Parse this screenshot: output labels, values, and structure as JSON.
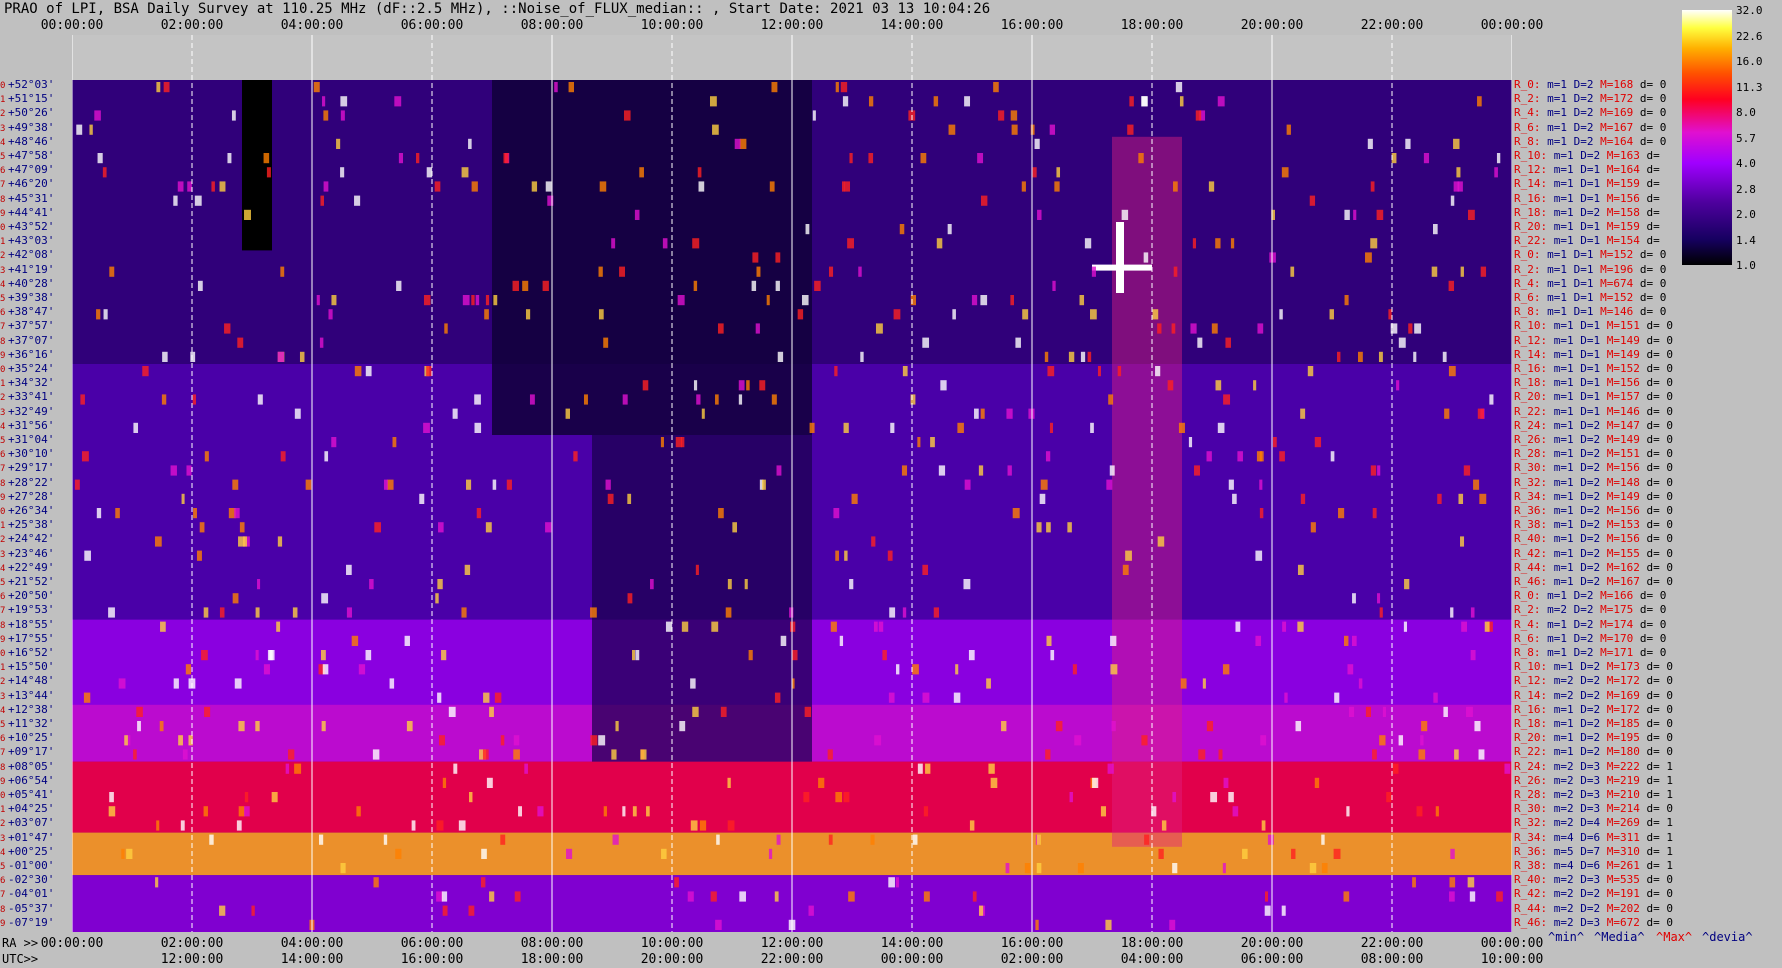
{
  "title": "PRAO of LPI, BSA Daily Survey at 110.25 MHz (dF::2.5 MHz), ::Noise_of_FLUX_median:: , Start Date: 2021 03 13 10:04:26",
  "top_ticks": [
    "00:00:00",
    "02:00:00",
    "04:00:00",
    "06:00:00",
    "08:00:00",
    "10:00:00",
    "12:00:00",
    "14:00:00",
    "16:00:00",
    "18:00:00",
    "20:00:00",
    "22:00:00",
    "00:00:00"
  ],
  "ra_prefix": "RA >>",
  "ra_ticks": [
    "00:00:00",
    "02:00:00",
    "04:00:00",
    "06:00:00",
    "08:00:00",
    "10:00:00",
    "12:00:00",
    "14:00:00",
    "16:00:00",
    "18:00:00",
    "20:00:00",
    "22:00:00",
    "00:00:00"
  ],
  "utc_prefix": "UTC>>",
  "utc_ticks": [
    "12:00:00",
    "14:00:00",
    "16:00:00",
    "18:00:00",
    "20:00:00",
    "22:00:00",
    "00:00:00",
    "02:00:00",
    "04:00:00",
    "06:00:00",
    "08:00:00",
    "10:00:00"
  ],
  "footer_legend": [
    "^min^",
    "^Media^",
    "^Max^",
    "^devia^"
  ],
  "colors": {
    "background": "#c0c0c0",
    "label_blue": "#000080",
    "label_red": "#e00000"
  },
  "chart_data": {
    "type": "heatmap",
    "title": "PRAO of LPI, BSA Daily Survey at 110.25 MHz (dF::2.5 MHz), ::Noise_of_FLUX_median:: , Start Date: 2021 03 13 10:04:26",
    "x_axis": "RA 00:00:00 to 24:00:00 (sidereal), with UTC row below",
    "grid": true,
    "colorbar": {
      "ticks": [
        32.0,
        22.6,
        16.0,
        11.3,
        8.0,
        5.7,
        4.0,
        2.8,
        2.0,
        1.4,
        1.0
      ]
    },
    "declinations": [
      "+52°03'",
      "+51°15'",
      "+50°26'",
      "+49°38'",
      "+48°46'",
      "+47°58'",
      "+47°09'",
      "+46°20'",
      "+45°31'",
      "+44°41'",
      "+43°52'",
      "+43°03'",
      "+42°08'",
      "+41°19'",
      "+40°28'",
      "+39°38'",
      "+38°47'",
      "+37°57'",
      "+37°07'",
      "+36°16'",
      "+35°24'",
      "+34°32'",
      "+33°41'",
      "+32°49'",
      "+31°56'",
      "+31°04'",
      "+30°10'",
      "+29°17'",
      "+28°22'",
      "+27°28'",
      "+26°34'",
      "+25°38'",
      "+24°42'",
      "+23°46'",
      "+22°49'",
      "+21°52'",
      "+20°50'",
      "+19°53'",
      "+18°55'",
      "+17°55'",
      "+16°52'",
      "+15°50'",
      "+14°48'",
      "+13°44'",
      "+12°38'",
      "+11°32'",
      "+10°25'",
      "+09°17'",
      "+08°05'",
      "+06°54'",
      "+05°41'",
      "+04°25'",
      "+03°07'",
      "+01°47'",
      "+00°25'",
      "-01°00'",
      "-02°30'",
      "-04°01'",
      "-05°37'",
      "-07°19'"
    ],
    "beam_stats": [
      {
        "r": "R_0:",
        "m": "m=1",
        "D": "D=2",
        "M": "M=168",
        "d": "d= 0"
      },
      {
        "r": "R_2:",
        "m": "m=1",
        "D": "D=2",
        "M": "M=172",
        "d": "d= 0"
      },
      {
        "r": "R_4:",
        "m": "m=1",
        "D": "D=2",
        "M": "M=169",
        "d": "d= 0"
      },
      {
        "r": "R_6:",
        "m": "m=1",
        "D": "D=2",
        "M": "M=167",
        "d": "d= 0"
      },
      {
        "r": "R_8:",
        "m": "m=1",
        "D": "D=2",
        "M": "M=164",
        "d": "d= 0"
      },
      {
        "r": "R_10:",
        "m": "m=1",
        "D": "D=2",
        "M": "M=163",
        "d": "d="
      },
      {
        "r": "R_12:",
        "m": "m=1",
        "D": "D=1",
        "M": "M=164",
        "d": "d="
      },
      {
        "r": "R_14:",
        "m": "m=1",
        "D": "D=1",
        "M": "M=159",
        "d": "d="
      },
      {
        "r": "R_16:",
        "m": "m=1",
        "D": "D=1",
        "M": "M=156",
        "d": "d="
      },
      {
        "r": "R_18:",
        "m": "m=1",
        "D": "D=2",
        "M": "M=158",
        "d": "d="
      },
      {
        "r": "R_20:",
        "m": "m=1",
        "D": "D=1",
        "M": "M=159",
        "d": "d="
      },
      {
        "r": "R_22:",
        "m": "m=1",
        "D": "D=1",
        "M": "M=154",
        "d": "d="
      },
      {
        "r": "R_0:",
        "m": "m=1",
        "D": "D=1",
        "M": "M=152",
        "d": "d= 0"
      },
      {
        "r": "R_2:",
        "m": "m=1",
        "D": "D=1",
        "M": "M=196",
        "d": "d= 0"
      },
      {
        "r": "R_4:",
        "m": "m=1",
        "D": "D=1",
        "M": "M=674",
        "d": "d= 0"
      },
      {
        "r": "R_6:",
        "m": "m=1",
        "D": "D=1",
        "M": "M=152",
        "d": "d= 0"
      },
      {
        "r": "R_8:",
        "m": "m=1",
        "D": "D=1",
        "M": "M=146",
        "d": "d= 0"
      },
      {
        "r": "R_10:",
        "m": "m=1",
        "D": "D=1",
        "M": "M=151",
        "d": "d= 0"
      },
      {
        "r": "R_12:",
        "m": "m=1",
        "D": "D=1",
        "M": "M=149",
        "d": "d= 0"
      },
      {
        "r": "R_14:",
        "m": "m=1",
        "D": "D=1",
        "M": "M=149",
        "d": "d= 0"
      },
      {
        "r": "R_16:",
        "m": "m=1",
        "D": "D=1",
        "M": "M=152",
        "d": "d= 0"
      },
      {
        "r": "R_18:",
        "m": "m=1",
        "D": "D=1",
        "M": "M=156",
        "d": "d= 0"
      },
      {
        "r": "R_20:",
        "m": "m=1",
        "D": "D=1",
        "M": "M=157",
        "d": "d= 0"
      },
      {
        "r": "R_22:",
        "m": "m=1",
        "D": "D=1",
        "M": "M=146",
        "d": "d= 0"
      },
      {
        "r": "R_24:",
        "m": "m=1",
        "D": "D=2",
        "M": "M=147",
        "d": "d= 0"
      },
      {
        "r": "R_26:",
        "m": "m=1",
        "D": "D=2",
        "M": "M=149",
        "d": "d= 0"
      },
      {
        "r": "R_28:",
        "m": "m=1",
        "D": "D=2",
        "M": "M=151",
        "d": "d= 0"
      },
      {
        "r": "R_30:",
        "m": "m=1",
        "D": "D=2",
        "M": "M=156",
        "d": "d= 0"
      },
      {
        "r": "R_32:",
        "m": "m=1",
        "D": "D=2",
        "M": "M=148",
        "d": "d= 0"
      },
      {
        "r": "R_34:",
        "m": "m=1",
        "D": "D=2",
        "M": "M=149",
        "d": "d= 0"
      },
      {
        "r": "R_36:",
        "m": "m=1",
        "D": "D=2",
        "M": "M=156",
        "d": "d= 0"
      },
      {
        "r": "R_38:",
        "m": "m=1",
        "D": "D=2",
        "M": "M=153",
        "d": "d= 0"
      },
      {
        "r": "R_40:",
        "m": "m=1",
        "D": "D=2",
        "M": "M=156",
        "d": "d= 0"
      },
      {
        "r": "R_42:",
        "m": "m=1",
        "D": "D=2",
        "M": "M=155",
        "d": "d= 0"
      },
      {
        "r": "R_44:",
        "m": "m=1",
        "D": "D=2",
        "M": "M=162",
        "d": "d= 0"
      },
      {
        "r": "R_46:",
        "m": "m=1",
        "D": "D=2",
        "M": "M=167",
        "d": "d= 0"
      },
      {
        "r": "R_0:",
        "m": "m=1",
        "D": "D=2",
        "M": "M=166",
        "d": "d= 0"
      },
      {
        "r": "R_2:",
        "m": "m=2",
        "D": "D=2",
        "M": "M=175",
        "d": "d= 0"
      },
      {
        "r": "R_4:",
        "m": "m=1",
        "D": "D=2",
        "M": "M=174",
        "d": "d= 0"
      },
      {
        "r": "R_6:",
        "m": "m=1",
        "D": "D=2",
        "M": "M=170",
        "d": "d= 0"
      },
      {
        "r": "R_8:",
        "m": "m=1",
        "D": "D=2",
        "M": "M=171",
        "d": "d= 0"
      },
      {
        "r": "R_10:",
        "m": "m=1",
        "D": "D=2",
        "M": "M=173",
        "d": "d= 0"
      },
      {
        "r": "R_12:",
        "m": "m=2",
        "D": "D=2",
        "M": "M=172",
        "d": "d= 0"
      },
      {
        "r": "R_14:",
        "m": "m=2",
        "D": "D=2",
        "M": "M=169",
        "d": "d= 0"
      },
      {
        "r": "R_16:",
        "m": "m=1",
        "D": "D=2",
        "M": "M=172",
        "d": "d= 0"
      },
      {
        "r": "R_18:",
        "m": "m=1",
        "D": "D=2",
        "M": "M=185",
        "d": "d= 0"
      },
      {
        "r": "R_20:",
        "m": "m=1",
        "D": "D=2",
        "M": "M=195",
        "d": "d= 0"
      },
      {
        "r": "R_22:",
        "m": "m=1",
        "D": "D=2",
        "M": "M=180",
        "d": "d= 0"
      },
      {
        "r": "R_24:",
        "m": "m=2",
        "D": "D=3",
        "M": "M=222",
        "d": "d= 1"
      },
      {
        "r": "R_26:",
        "m": "m=2",
        "D": "D=3",
        "M": "M=219",
        "d": "d= 1"
      },
      {
        "r": "R_28:",
        "m": "m=2",
        "D": "D=3",
        "M": "M=210",
        "d": "d= 1"
      },
      {
        "r": "R_30:",
        "m": "m=2",
        "D": "D=3",
        "M": "M=214",
        "d": "d= 0"
      },
      {
        "r": "R_32:",
        "m": "m=2",
        "D": "D=4",
        "M": "M=269",
        "d": "d= 1"
      },
      {
        "r": "R_34:",
        "m": "m=4",
        "D": "D=6",
        "M": "M=311",
        "d": "d= 1"
      },
      {
        "r": "R_36:",
        "m": "m=5",
        "D": "D=7",
        "M": "M=310",
        "d": "d= 1"
      },
      {
        "r": "R_38:",
        "m": "m=4",
        "D": "D=6",
        "M": "M=261",
        "d": "d= 1"
      },
      {
        "r": "R_40:",
        "m": "m=2",
        "D": "D=3",
        "M": "M=535",
        "d": "d= 0"
      },
      {
        "r": "R_42:",
        "m": "m=2",
        "D": "D=2",
        "M": "M=191",
        "d": "d= 0"
      },
      {
        "r": "R_44:",
        "m": "m=2",
        "D": "D=2",
        "M": "M=202",
        "d": "d= 0"
      },
      {
        "r": "R_46:",
        "m": "m=2",
        "D": "D=3",
        "M": "M=672",
        "d": "d= 0"
      }
    ]
  }
}
